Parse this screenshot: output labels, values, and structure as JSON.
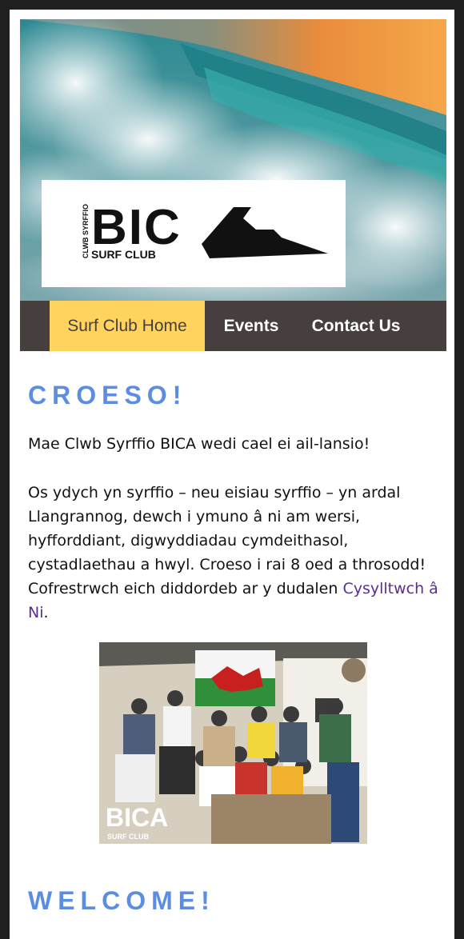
{
  "header": {
    "logo_text": "BICA",
    "logo_sub": "SURF CLUB",
    "logo_vertical": "CLWB SYRFFIO"
  },
  "nav": {
    "home": "Surf Club Home",
    "events": "Events",
    "contact": "Contact Us"
  },
  "content": {
    "heading_croeso": "CROESO!",
    "para1": "Mae Clwb Syrffio BICA wedi cael ei ail-lansio!",
    "para2": "Os ydych yn syrffio – neu eisiau syrffio – yn ardal Llangrannog, dewch i ymuno â ni am wersi, hyfforddiant, digwyddiadau cymdeithasol, cystadlaethau a hwyl. Croeso i rai 8 oed a throsodd! Cofrestrwch eich diddordeb ar y dudalen ",
    "para2_link": "Cysylltwch â Ni",
    "para2_end": ".",
    "heading_welcome": "WELCOME!"
  },
  "photo": {
    "watermark": "BICA",
    "watermark_sub": "SURF CLUB"
  },
  "colors": {
    "accent": "#5b8de3",
    "nav_bg": "#463f3e",
    "nav_active": "#fed45e",
    "link": "#5b2d8e"
  }
}
